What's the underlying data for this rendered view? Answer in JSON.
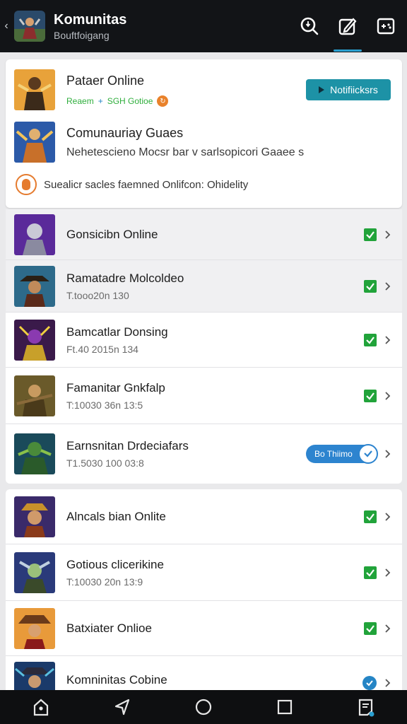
{
  "app": {
    "title": "Komunitas",
    "subtitle": "Bouftfoigang",
    "actions": [
      "search-icon",
      "edit-icon",
      "game-controller-icon"
    ]
  },
  "header": {
    "title": "Pataer Online",
    "tag_green": "Reaem",
    "tag_sep": "+",
    "tag_blue": "SGH Gotioe",
    "notify_label": "Notifiicksrs",
    "community_title": "Comunauriay Guaes",
    "community_desc": "Nehetescieno Mocsr bar v sarlsopicori Gaaee s",
    "note_text": "Suealicr sacles faemned Onlifcon: Ohidelity"
  },
  "list_group_1": [
    {
      "title": "Gonsicibn Online",
      "sub": "",
      "status": "check",
      "highlight": true
    },
    {
      "title": "Ramatadre Molcoldeo",
      "sub": "T.tooo20n 130",
      "status": "check",
      "highlight": true
    },
    {
      "title": "Bamcatlar Donsing",
      "sub": "Ft.40 2015n 134",
      "status": "check",
      "highlight": false
    },
    {
      "title": "Famanitar Gnkfalp",
      "sub": "T:10030 36n 13:5",
      "status": "check",
      "highlight": false
    },
    {
      "title": "Earnsnitan Drdeciafars",
      "sub": "T1.5030 100 03:8",
      "status": "pill",
      "pill_label": "Bo Thiimo",
      "highlight": false
    }
  ],
  "list_group_2": [
    {
      "title": "Alncals bian Onlite",
      "sub": "",
      "status": "check"
    },
    {
      "title": "Gotious clicerikine",
      "sub": "T:10030 20n 13:9",
      "status": "check"
    },
    {
      "title": "Batxiater Onlioe",
      "sub": "",
      "status": "check"
    },
    {
      "title": "Komninitas Cobine",
      "sub": "",
      "status": "blue-check"
    }
  ],
  "navbar": [
    "home-icon",
    "back-triangle-icon",
    "home-circle-icon",
    "recents-square-icon",
    "notes-icon"
  ],
  "colors": {
    "appbar": "#121417",
    "accent": "#1d92a6",
    "check_green": "#21a33a",
    "pill_blue": "#2d84cf",
    "note_orange": "#e57b2e"
  }
}
